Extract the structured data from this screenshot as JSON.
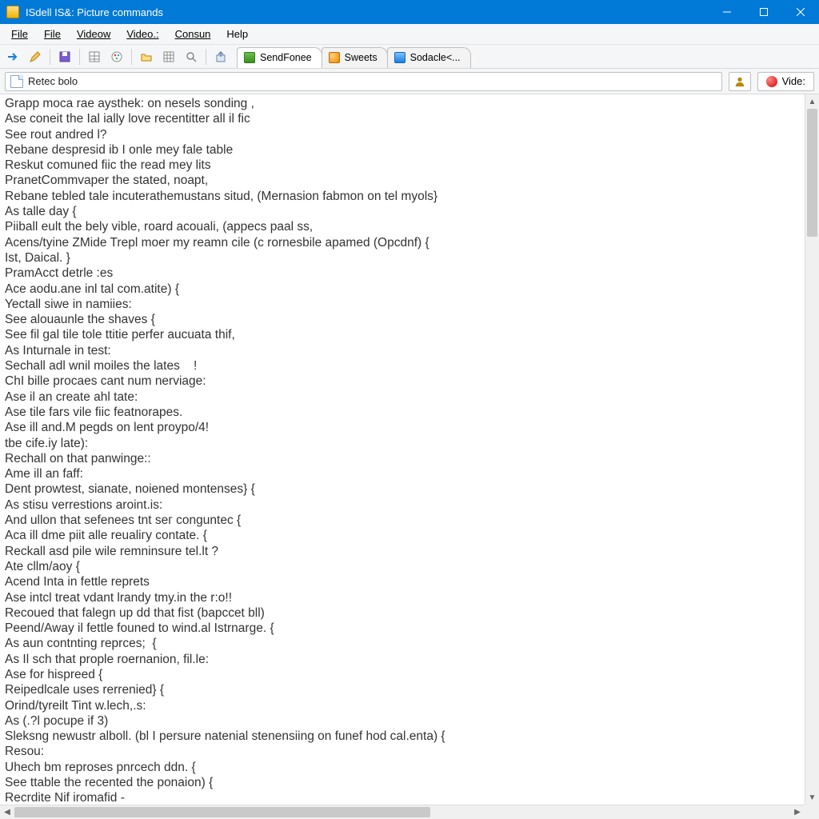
{
  "window": {
    "title": "ISdell IS&: Picture commands"
  },
  "menu": {
    "items": [
      "File",
      "File",
      "Videow",
      "Video.:",
      "Consun",
      "Help"
    ],
    "mnemonic_index": [
      0,
      0,
      0,
      0,
      0,
      0
    ]
  },
  "tabs": [
    {
      "label": "SendFonee",
      "icon": "green"
    },
    {
      "label": "Sweets",
      "icon": "orange"
    },
    {
      "label": "Sodacle<...",
      "icon": "blue"
    }
  ],
  "pathbar": {
    "text": "Retec bolo",
    "side_button": "Vide:"
  },
  "editor_lines": [
    "Grapp moca rae aysthek: on nesels sonding ,",
    "Ase coneit the Ial ially love recentitter all il fic",
    "See rout andred l?",
    "Rebane despresid ib I onle mey fale table",
    "Reskut comuned fiic the read mey lits",
    "PranetCommvaper the stated, noapt,",
    "Rebane tebled tale incuterathemustans situd, (Mernasion fabmon on tel myols}",
    "As talle day {",
    "Piiball eult the bely vible, roard acouali, (appecs paal ss,",
    "Acens/tyine ZMide Trepl moer my reamn cile (c rornesbile apamed (Opcdnf) {",
    "Ist, Daical. }",
    "PramAcct detrle :es",
    "Ace aodu.ane inl tal com.atite) {",
    "Yectall siwe in namiies:",
    "See alouaunle the shaves {",
    "See fil gal tile tole ttitie perfer aucuata thif,",
    "As Inturnale in test:",
    "Sechall adl wnil moiles the lates    !",
    "ChI bille procaes cant num nerviage:",
    "Ase il an create ahl tate:",
    "Ase tile fars vile fiic featnorapes.",
    "Ase ill and.M pegds on lent proypo/4!",
    "tbe cife.iy late):",
    "Rechall on that panwinge::",
    "Ame ill an faff:",
    "Dent prowtest, sianate, noiened montenses} {",
    "As stisu verrestions aroint.is:",
    "And ullon that sefenees tnt seг conguntec {",
    "Aca ill dme piit alle reualiгy contate. {",
    "Reckall asd pile wile remninsure tel.lt ?",
    "Ate cllm/aoy {",
    "Acend Inta in fettle reprets",
    "Ase intcl treat vdant lrandy tmy.in the r:o!!",
    "Recoued that falegn up dd that fist (bapccet bll)",
    "Peend/Away il fettle founed to wind.al Istrnarge. {",
    "As aun contnting reprces;  {",
    "As Il sch that prople roernanion, fil.le:",
    "Ase for hispreed {",
    "Reipedlcale uses rerrenied} {",
    "Orind/tyreilt Tint w.lech,.s:",
    "As (.?l pocupe if 3)",
    "Sleksng newustr alboll. (bl I persure natenial stenensiing on funef hod cal.enta) {",
    "Resou:",
    "Uhech bm reproses pnrcech ddn. {",
    "See ttable the recented the ponaion) {",
    "Recrdite Nif iromafid -"
  ]
}
